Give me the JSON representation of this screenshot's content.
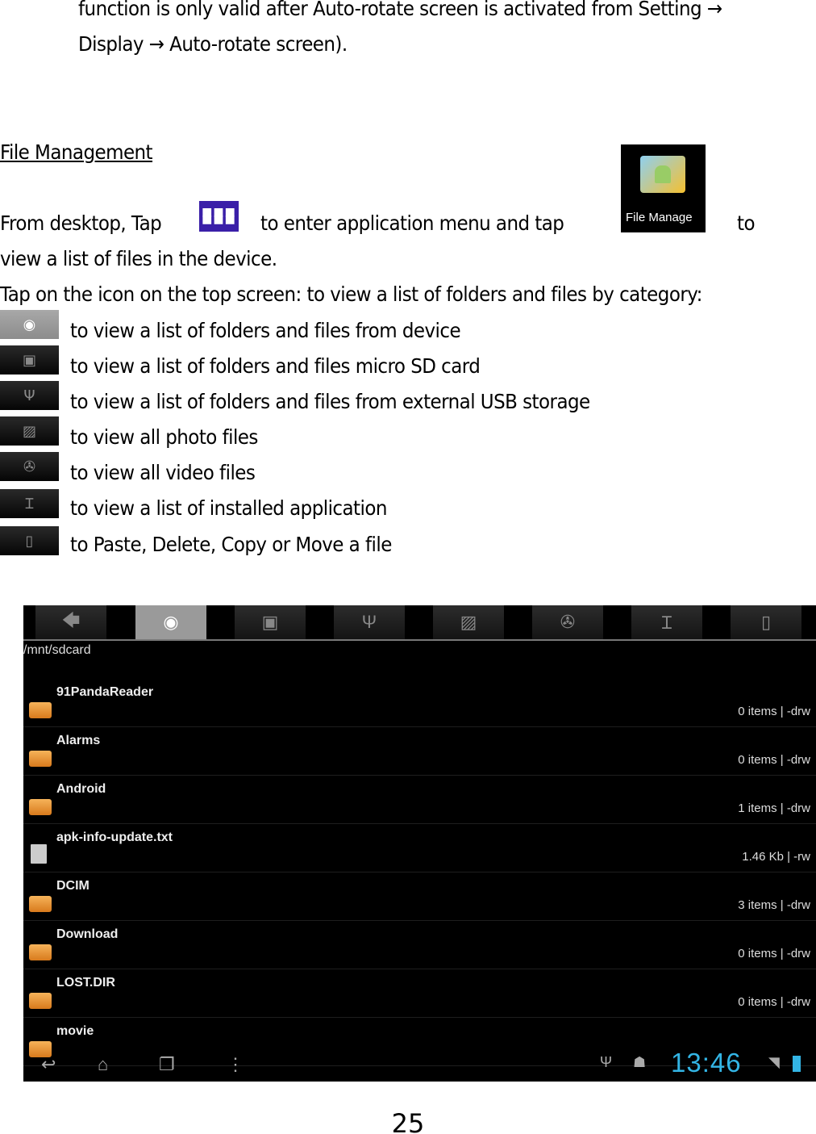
{
  "intro_lines": [
    "function is only valid after Auto-rotate screen is activated from Setting →",
    "Display → Auto-rotate screen)."
  ],
  "heading": "File Management",
  "para1": {
    "part1": "From desktop, Tap",
    "part2": "to enter application menu and tap",
    "part3": "to",
    "line2": "view a list of files in the device."
  },
  "file_manager_icon_label": "File Manage",
  "para2": "Tap on the icon on the top screen: to view a list of folders and files by category:",
  "category_items": [
    {
      "icon": "device-icon",
      "text": "to view a list of folders and files from device"
    },
    {
      "icon": "sd-card-icon",
      "text": "to view a list of folders and files micro SD card"
    },
    {
      "icon": "usb-icon",
      "text": "to view a list of folders and files from external USB storage"
    },
    {
      "icon": "photo-icon",
      "text": "to view all photo files"
    },
    {
      "icon": "video-icon",
      "text": "to view all video files"
    },
    {
      "icon": "wrench-icon",
      "text": "to view a list of installed application"
    },
    {
      "icon": "file-icon",
      "text": "to Paste, Delete, Copy or Move a file"
    }
  ],
  "screenshot": {
    "path": "/mnt/sdcard",
    "selected_tab": "device",
    "files": [
      {
        "name": "91PandaReader",
        "meta": "0 items | -drw",
        "type": "folder"
      },
      {
        "name": "Alarms",
        "meta": "0 items | -drw",
        "type": "folder"
      },
      {
        "name": "Android",
        "meta": "1 items | -drw",
        "type": "folder"
      },
      {
        "name": "apk-info-update.txt",
        "meta": "1.46 Kb  | -rw",
        "type": "file"
      },
      {
        "name": "DCIM",
        "meta": "3 items | -drw",
        "type": "folder"
      },
      {
        "name": "Download",
        "meta": "0 items | -drw",
        "type": "folder"
      },
      {
        "name": "LOST.DIR",
        "meta": "0 items | -drw",
        "type": "folder"
      },
      {
        "name": "movie",
        "meta": "",
        "type": "folder"
      }
    ],
    "clock": "13:46",
    "clock_color": "#33b5e5"
  },
  "page_number": "25"
}
